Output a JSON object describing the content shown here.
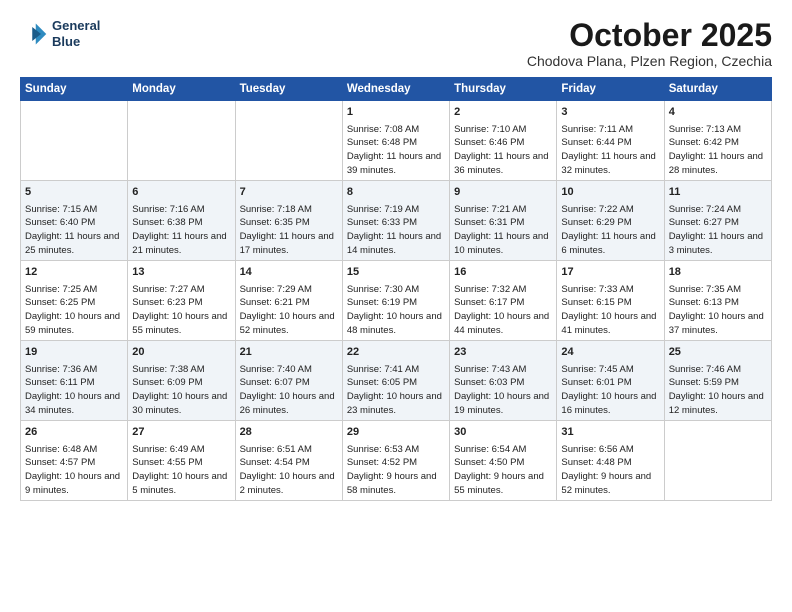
{
  "header": {
    "logo_line1": "General",
    "logo_line2": "Blue",
    "month": "October 2025",
    "location": "Chodova Plana, Plzen Region, Czechia"
  },
  "days_of_week": [
    "Sunday",
    "Monday",
    "Tuesday",
    "Wednesday",
    "Thursday",
    "Friday",
    "Saturday"
  ],
  "weeks": [
    [
      {
        "day": "",
        "sunrise": "",
        "sunset": "",
        "daylight": ""
      },
      {
        "day": "",
        "sunrise": "",
        "sunset": "",
        "daylight": ""
      },
      {
        "day": "",
        "sunrise": "",
        "sunset": "",
        "daylight": ""
      },
      {
        "day": "1",
        "sunrise": "Sunrise: 7:08 AM",
        "sunset": "Sunset: 6:48 PM",
        "daylight": "Daylight: 11 hours and 39 minutes."
      },
      {
        "day": "2",
        "sunrise": "Sunrise: 7:10 AM",
        "sunset": "Sunset: 6:46 PM",
        "daylight": "Daylight: 11 hours and 36 minutes."
      },
      {
        "day": "3",
        "sunrise": "Sunrise: 7:11 AM",
        "sunset": "Sunset: 6:44 PM",
        "daylight": "Daylight: 11 hours and 32 minutes."
      },
      {
        "day": "4",
        "sunrise": "Sunrise: 7:13 AM",
        "sunset": "Sunset: 6:42 PM",
        "daylight": "Daylight: 11 hours and 28 minutes."
      }
    ],
    [
      {
        "day": "5",
        "sunrise": "Sunrise: 7:15 AM",
        "sunset": "Sunset: 6:40 PM",
        "daylight": "Daylight: 11 hours and 25 minutes."
      },
      {
        "day": "6",
        "sunrise": "Sunrise: 7:16 AM",
        "sunset": "Sunset: 6:38 PM",
        "daylight": "Daylight: 11 hours and 21 minutes."
      },
      {
        "day": "7",
        "sunrise": "Sunrise: 7:18 AM",
        "sunset": "Sunset: 6:35 PM",
        "daylight": "Daylight: 11 hours and 17 minutes."
      },
      {
        "day": "8",
        "sunrise": "Sunrise: 7:19 AM",
        "sunset": "Sunset: 6:33 PM",
        "daylight": "Daylight: 11 hours and 14 minutes."
      },
      {
        "day": "9",
        "sunrise": "Sunrise: 7:21 AM",
        "sunset": "Sunset: 6:31 PM",
        "daylight": "Daylight: 11 hours and 10 minutes."
      },
      {
        "day": "10",
        "sunrise": "Sunrise: 7:22 AM",
        "sunset": "Sunset: 6:29 PM",
        "daylight": "Daylight: 11 hours and 6 minutes."
      },
      {
        "day": "11",
        "sunrise": "Sunrise: 7:24 AM",
        "sunset": "Sunset: 6:27 PM",
        "daylight": "Daylight: 11 hours and 3 minutes."
      }
    ],
    [
      {
        "day": "12",
        "sunrise": "Sunrise: 7:25 AM",
        "sunset": "Sunset: 6:25 PM",
        "daylight": "Daylight: 10 hours and 59 minutes."
      },
      {
        "day": "13",
        "sunrise": "Sunrise: 7:27 AM",
        "sunset": "Sunset: 6:23 PM",
        "daylight": "Daylight: 10 hours and 55 minutes."
      },
      {
        "day": "14",
        "sunrise": "Sunrise: 7:29 AM",
        "sunset": "Sunset: 6:21 PM",
        "daylight": "Daylight: 10 hours and 52 minutes."
      },
      {
        "day": "15",
        "sunrise": "Sunrise: 7:30 AM",
        "sunset": "Sunset: 6:19 PM",
        "daylight": "Daylight: 10 hours and 48 minutes."
      },
      {
        "day": "16",
        "sunrise": "Sunrise: 7:32 AM",
        "sunset": "Sunset: 6:17 PM",
        "daylight": "Daylight: 10 hours and 44 minutes."
      },
      {
        "day": "17",
        "sunrise": "Sunrise: 7:33 AM",
        "sunset": "Sunset: 6:15 PM",
        "daylight": "Daylight: 10 hours and 41 minutes."
      },
      {
        "day": "18",
        "sunrise": "Sunrise: 7:35 AM",
        "sunset": "Sunset: 6:13 PM",
        "daylight": "Daylight: 10 hours and 37 minutes."
      }
    ],
    [
      {
        "day": "19",
        "sunrise": "Sunrise: 7:36 AM",
        "sunset": "Sunset: 6:11 PM",
        "daylight": "Daylight: 10 hours and 34 minutes."
      },
      {
        "day": "20",
        "sunrise": "Sunrise: 7:38 AM",
        "sunset": "Sunset: 6:09 PM",
        "daylight": "Daylight: 10 hours and 30 minutes."
      },
      {
        "day": "21",
        "sunrise": "Sunrise: 7:40 AM",
        "sunset": "Sunset: 6:07 PM",
        "daylight": "Daylight: 10 hours and 26 minutes."
      },
      {
        "day": "22",
        "sunrise": "Sunrise: 7:41 AM",
        "sunset": "Sunset: 6:05 PM",
        "daylight": "Daylight: 10 hours and 23 minutes."
      },
      {
        "day": "23",
        "sunrise": "Sunrise: 7:43 AM",
        "sunset": "Sunset: 6:03 PM",
        "daylight": "Daylight: 10 hours and 19 minutes."
      },
      {
        "day": "24",
        "sunrise": "Sunrise: 7:45 AM",
        "sunset": "Sunset: 6:01 PM",
        "daylight": "Daylight: 10 hours and 16 minutes."
      },
      {
        "day": "25",
        "sunrise": "Sunrise: 7:46 AM",
        "sunset": "Sunset: 5:59 PM",
        "daylight": "Daylight: 10 hours and 12 minutes."
      }
    ],
    [
      {
        "day": "26",
        "sunrise": "Sunrise: 6:48 AM",
        "sunset": "Sunset: 4:57 PM",
        "daylight": "Daylight: 10 hours and 9 minutes."
      },
      {
        "day": "27",
        "sunrise": "Sunrise: 6:49 AM",
        "sunset": "Sunset: 4:55 PM",
        "daylight": "Daylight: 10 hours and 5 minutes."
      },
      {
        "day": "28",
        "sunrise": "Sunrise: 6:51 AM",
        "sunset": "Sunset: 4:54 PM",
        "daylight": "Daylight: 10 hours and 2 minutes."
      },
      {
        "day": "29",
        "sunrise": "Sunrise: 6:53 AM",
        "sunset": "Sunset: 4:52 PM",
        "daylight": "Daylight: 9 hours and 58 minutes."
      },
      {
        "day": "30",
        "sunrise": "Sunrise: 6:54 AM",
        "sunset": "Sunset: 4:50 PM",
        "daylight": "Daylight: 9 hours and 55 minutes."
      },
      {
        "day": "31",
        "sunrise": "Sunrise: 6:56 AM",
        "sunset": "Sunset: 4:48 PM",
        "daylight": "Daylight: 9 hours and 52 minutes."
      },
      {
        "day": "",
        "sunrise": "",
        "sunset": "",
        "daylight": ""
      }
    ]
  ]
}
